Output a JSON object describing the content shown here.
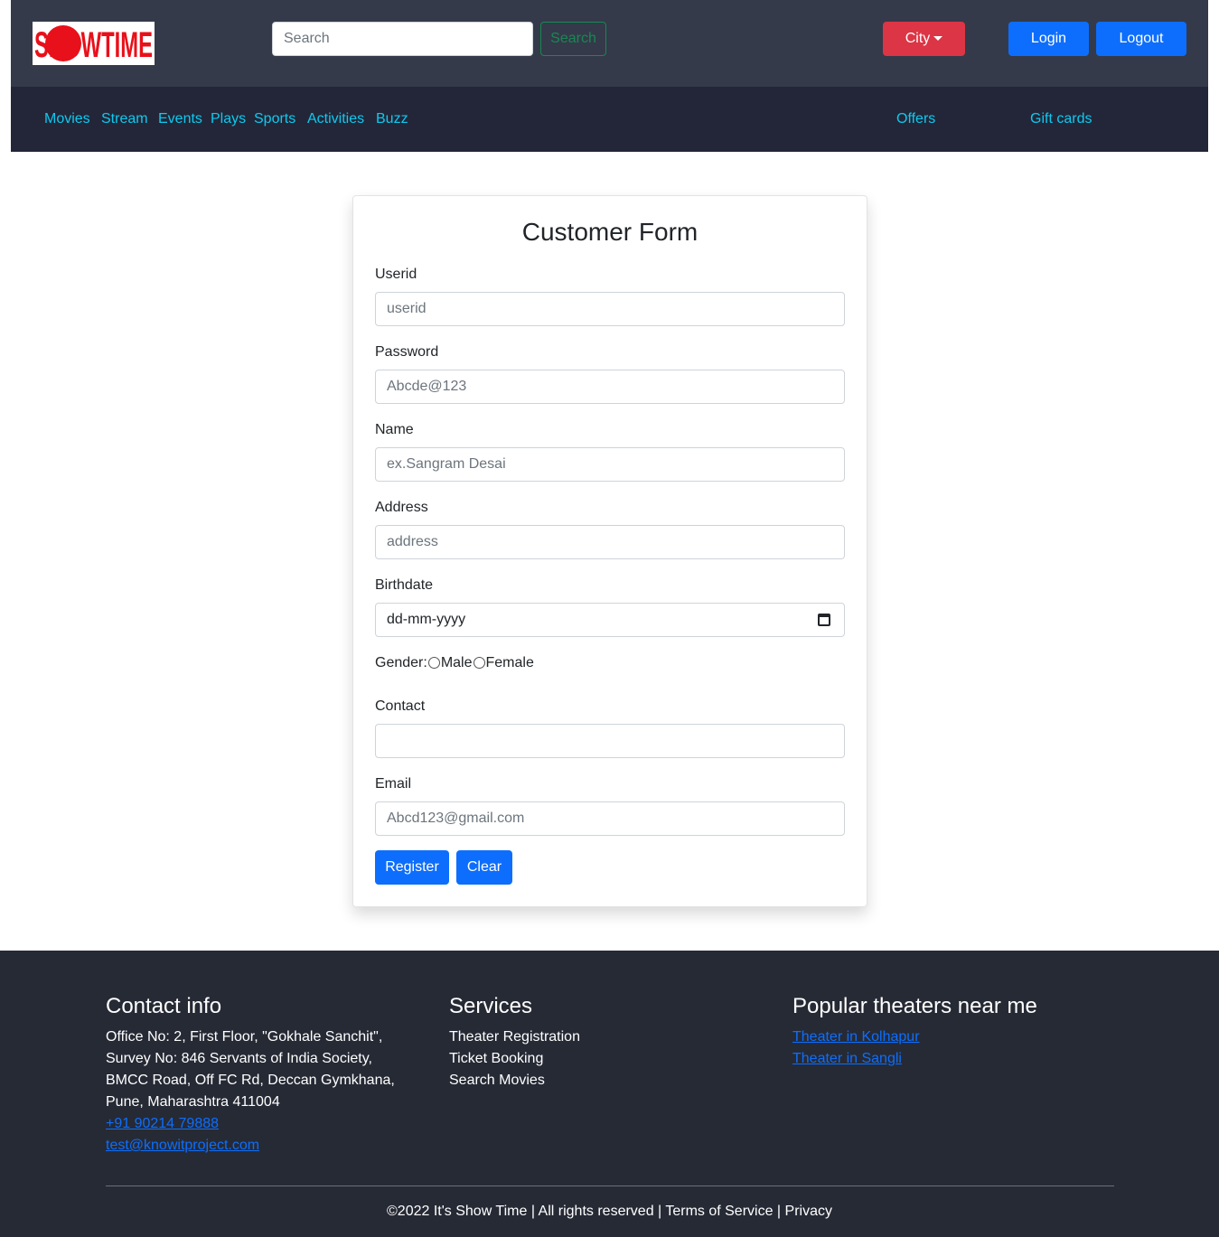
{
  "header": {
    "logo_text": "SHOWTIME",
    "search_placeholder": "Search",
    "search_button": "Search",
    "city_button": "City",
    "login_button": "Login",
    "logout_button": "Logout"
  },
  "nav": {
    "left": [
      "Movies",
      "Stream",
      "Events",
      "Plays",
      "Sports",
      "Activities",
      "Buzz"
    ],
    "offers": "Offers",
    "gift_cards": "Gift cards"
  },
  "form": {
    "title": "Customer Form",
    "userid_label": "Userid",
    "userid_placeholder": "userid",
    "password_label": "Password",
    "password_placeholder": "Abcde@123",
    "name_label": "Name",
    "name_placeholder": "ex.Sangram Desai",
    "address_label": "Address",
    "address_placeholder": "address",
    "birthdate_label": "Birthdate",
    "birthdate_value": "dd-mm-yyyy",
    "gender_label": "Gender:",
    "gender_male": "Male",
    "gender_female": "Female",
    "contact_label": "Contact",
    "contact_value": "",
    "email_label": "Email",
    "email_placeholder": "Abcd123@gmail.com",
    "register_button": "Register",
    "clear_button": "Clear"
  },
  "footer": {
    "contact_heading": "Contact info",
    "address_lines": [
      "Office No: 2, First Floor, \"Gokhale Sanchit\",",
      "Survey No: 846 Servants of India Society,",
      "BMCC Road, Off FC Rd, Deccan Gymkhana,",
      "Pune, Maharashtra 411004"
    ],
    "phone": "+91 90214 79888",
    "email": "test@knowitproject.com",
    "services_heading": "Services",
    "services": [
      "Theater Registration",
      "Ticket Booking",
      "Search Movies"
    ],
    "theaters_heading": "Popular theaters near me",
    "theaters": [
      "Theater in Kolhapur",
      "Theater in Sangli"
    ],
    "copyright": "©2022 It's Show Time | All rights reserved | Terms of Service | Privacy"
  },
  "colors": {
    "topbar": "#343a49",
    "navbar": "#232638",
    "nav_link": "#0dcaf0",
    "primary": "#0d6efd",
    "danger": "#dc3545",
    "success": "#198754",
    "footer": "#262a35",
    "logo_red": "#e8101a"
  }
}
